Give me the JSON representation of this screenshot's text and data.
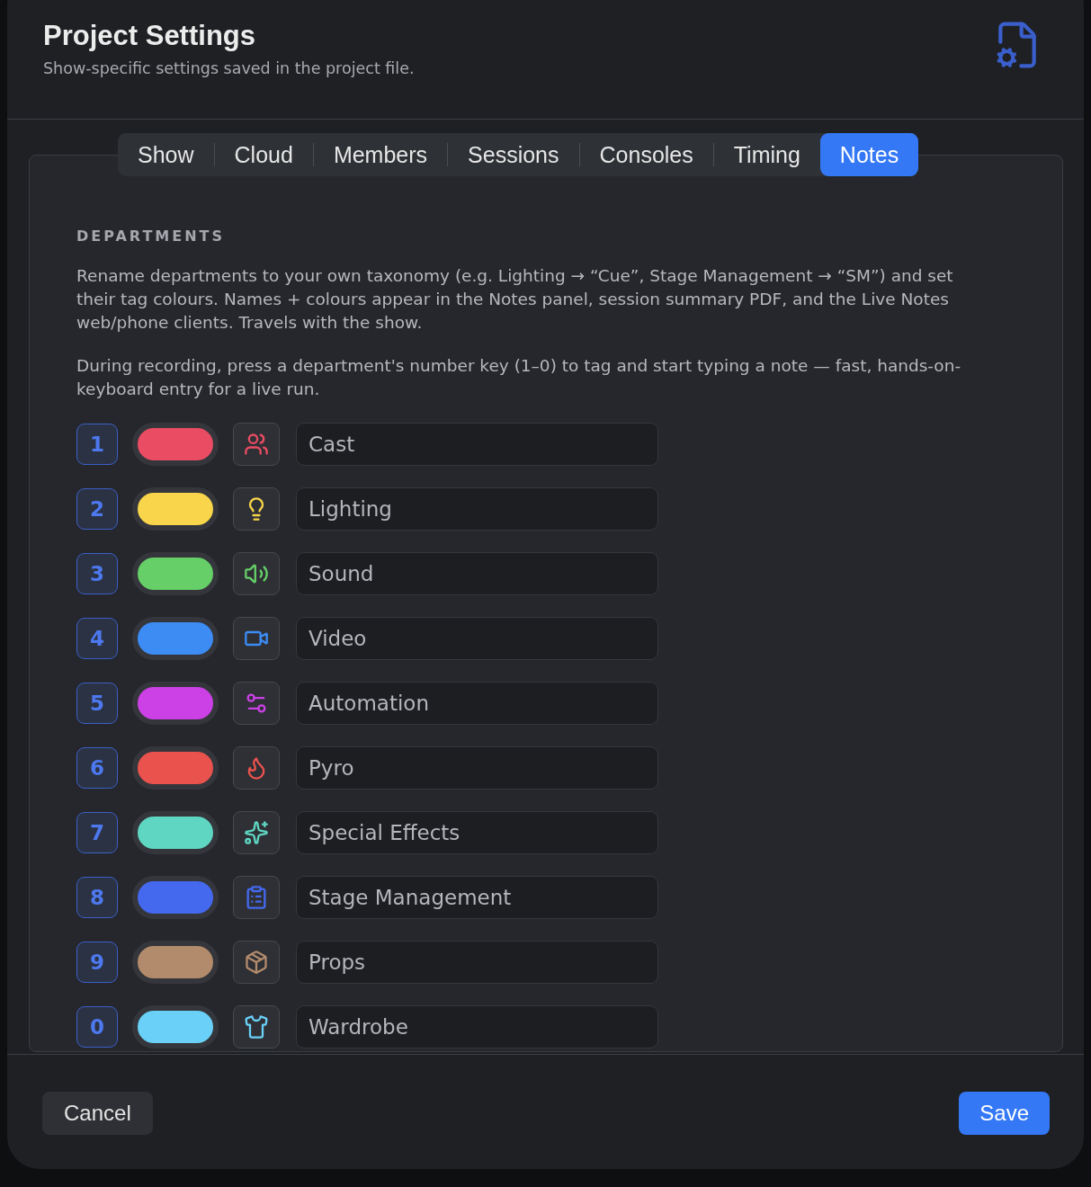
{
  "dialog": {
    "title": "Project Settings",
    "subtitle": "Show-specific settings saved in the project file."
  },
  "tabs": [
    {
      "label": "Show",
      "selected": false
    },
    {
      "label": "Cloud",
      "selected": false
    },
    {
      "label": "Members",
      "selected": false
    },
    {
      "label": "Sessions",
      "selected": false
    },
    {
      "label": "Consoles",
      "selected": false
    },
    {
      "label": "Timing",
      "selected": false
    },
    {
      "label": "Notes",
      "selected": true
    }
  ],
  "section": {
    "heading": "DEPARTMENTS",
    "paragraphs": [
      "Rename departments to your own taxonomy (e.g. Lighting → “Cue”, Stage Management → “SM”) and set their tag colours. Names + colours appear in the Notes panel, session summary PDF, and the Live Notes web/phone clients. Travels with the show.",
      "During recording, press a department's number key (1–0) to tag and start typing a note — fast, hands-on-keyboard entry for a live run."
    ]
  },
  "departments": [
    {
      "key": "1",
      "color": "#e94c63",
      "name": "Cast"
    },
    {
      "key": "2",
      "color": "#f8d54a",
      "name": "Lighting"
    },
    {
      "key": "3",
      "color": "#66cf68",
      "name": "Sound"
    },
    {
      "key": "4",
      "color": "#3c8cf4",
      "name": "Video"
    },
    {
      "key": "5",
      "color": "#cc41e6",
      "name": "Automation"
    },
    {
      "key": "6",
      "color": "#ea524e",
      "name": "Pyro"
    },
    {
      "key": "7",
      "color": "#5fd6c2",
      "name": "Special Effects"
    },
    {
      "key": "8",
      "color": "#4469ef",
      "name": "Stage Management"
    },
    {
      "key": "9",
      "color": "#b28b6c",
      "name": "Props"
    },
    {
      "key": "0",
      "color": "#6ad0f7",
      "name": "Wardrobe"
    }
  ],
  "buttons": {
    "cancel": "Cancel",
    "save": "Save"
  }
}
